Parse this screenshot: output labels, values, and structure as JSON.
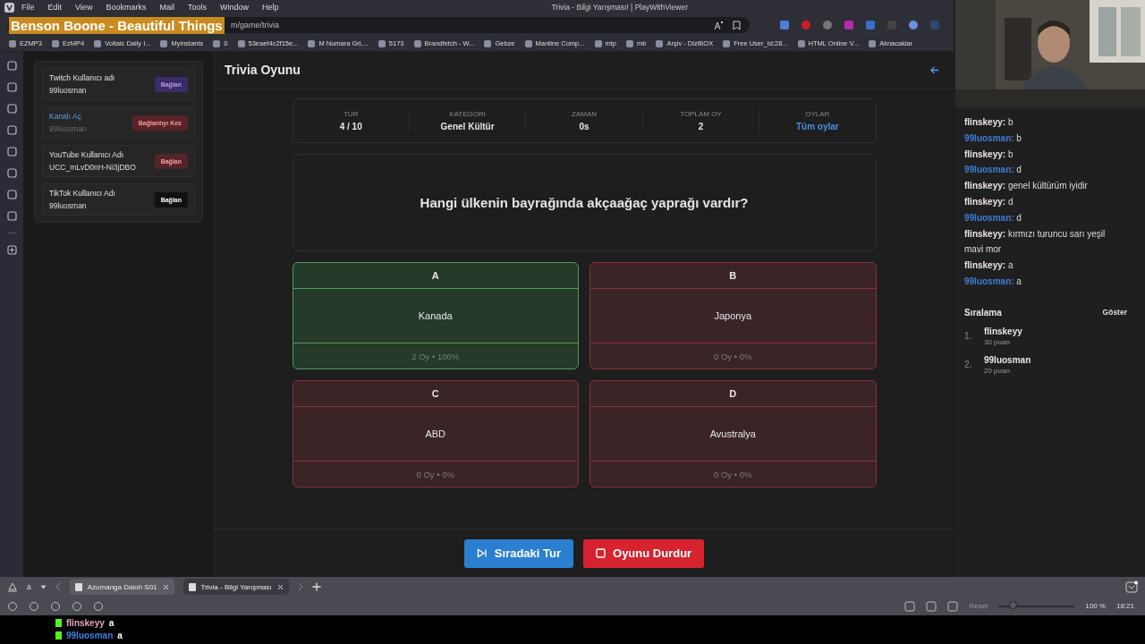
{
  "browser": {
    "menu": [
      "File",
      "Edit",
      "View",
      "Bookmarks",
      "Mail",
      "Tools",
      "Window",
      "Help"
    ],
    "window_title": "Trivia - Bilgi Yarışması! | PlayWithViewer",
    "address": "m/game/trivia",
    "overlay_title": "Benson Boone - Beautiful Things",
    "bookmarks": [
      {
        "label": "EZMP3"
      },
      {
        "label": "EzMP4"
      },
      {
        "label": "Voltaic Daily I..."
      },
      {
        "label": "Myinstants"
      },
      {
        "label": "0"
      },
      {
        "label": "53eaef4c2f15e..."
      },
      {
        "label": "M Numara Gri,..."
      },
      {
        "label": "5173"
      },
      {
        "label": "Brandfetch - W..."
      },
      {
        "label": "Gebze"
      },
      {
        "label": "Mantine Comp..."
      },
      {
        "label": "mtp"
      },
      {
        "label": "mb"
      },
      {
        "label": "Arşiv - DiziBOX"
      },
      {
        "label": "Free User_Id:28..."
      },
      {
        "label": "HTML Online V..."
      },
      {
        "label": "Alınacaklar"
      }
    ]
  },
  "sidebar": {
    "accounts": [
      {
        "label": "Twitch Kullanıcı adı",
        "value": "99luosman",
        "button": "Bağlan",
        "kind": "twitch"
      },
      {
        "label": "Kanalı Aç",
        "value": "99luosman",
        "button": "Bağlantıyı Kes",
        "kind": "disconnect"
      },
      {
        "label": "YouTube Kullanıcı Adı",
        "value": "UCC_mLvD0nH-Ni3jDBO",
        "button": "Bağlan",
        "kind": "youtube"
      },
      {
        "label": "TikTok Kullanıcı Adı",
        "value": "99luosman",
        "button": "Bağlan",
        "kind": "tiktok"
      }
    ]
  },
  "game": {
    "title": "Trivia Oyunu",
    "stats": [
      {
        "label": "TUR",
        "value": "4 / 10",
        "kind": "text"
      },
      {
        "label": "KATEGORI",
        "value": "Genel Kültür",
        "kind": "text"
      },
      {
        "label": "ZAMAN",
        "value": "0s",
        "kind": "text"
      },
      {
        "label": "TOPLAM OY",
        "value": "2",
        "kind": "text"
      },
      {
        "label": "OYLAR",
        "value": "Tüm oylar",
        "kind": "link"
      }
    ],
    "question": "Hangi ülkenin bayrağında akçaağaç yaprağı vardır?",
    "answers": [
      {
        "letter": "A",
        "text": "Kanada",
        "votes": "2 Oy • 100%",
        "correct": true
      },
      {
        "letter": "B",
        "text": "Japonya",
        "votes": "0 Oy • 0%",
        "correct": false
      },
      {
        "letter": "C",
        "text": "ABD",
        "votes": "0 Oy • 0%",
        "correct": false
      },
      {
        "letter": "D",
        "text": "Avustralya",
        "votes": "0 Oy • 0%",
        "correct": false
      }
    ],
    "actions": [
      {
        "label": "Sıradaki Tur",
        "kind": "next"
      },
      {
        "label": "Oyunu Durdur",
        "kind": "stop"
      }
    ]
  },
  "chat": {
    "messages": [
      {
        "user": "flinskeyy:",
        "text": "b",
        "color": "#efe3e8"
      },
      {
        "user": "99luosman:",
        "text": "b",
        "color": "#3b7fd6"
      },
      {
        "user": "flinskeyy:",
        "text": "b",
        "color": "#efe3e8"
      },
      {
        "user": "99luosman:",
        "text": "d",
        "color": "#3b7fd6"
      },
      {
        "user": "flinskeyy:",
        "text": "genel kültürüm iyidir",
        "color": "#efe3e8"
      },
      {
        "user": "flinskeyy:",
        "text": "d",
        "color": "#efe3e8"
      },
      {
        "user": "99luosman:",
        "text": "d",
        "color": "#3b7fd6"
      },
      {
        "user": "flinskeyy:",
        "text": "kırmızı turuncu sarı yeşil mavi mor",
        "color": "#efe3e8"
      },
      {
        "user": "flinskeyy:",
        "text": "a",
        "color": "#efe3e8"
      },
      {
        "user": "99luosman:",
        "text": "a",
        "color": "#3b7fd6"
      }
    ],
    "leaderboard": {
      "title": "Sıralama",
      "toggle": "Göster",
      "entries": [
        {
          "rank": "1.",
          "name": "flinskeyy",
          "points": "30 puan"
        },
        {
          "rank": "2.",
          "name": "99luosman",
          "points": "20 puan"
        }
      ]
    }
  },
  "tab_bar": {
    "workspace": "a",
    "tabs": [
      {
        "title": "Azumanga Daioh S01",
        "selected": true
      },
      {
        "title": "Trivia - Bilgi Yarışması",
        "selected": false
      }
    ]
  },
  "status_bar": {
    "reset": "Reset",
    "level": 0.2,
    "zoom": "100 %",
    "clock": "18:21"
  },
  "stream_overlay": [
    {
      "user": "flinskeyy",
      "text": "a",
      "color": "#e9a3bd"
    },
    {
      "user": "99luosman",
      "text": "a",
      "color": "#3d82e0"
    }
  ]
}
